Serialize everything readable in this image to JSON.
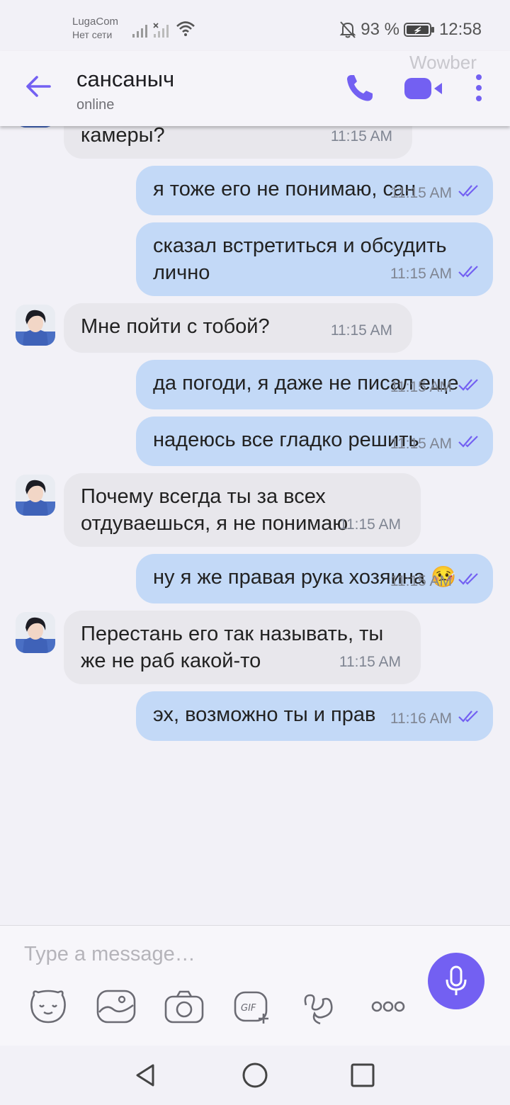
{
  "status": {
    "carrier": "LugaCom",
    "network": "Нет сети",
    "battery": "93 %",
    "time": "12:58"
  },
  "header": {
    "title": "сансаныч",
    "subtitle": "online",
    "watermark": "Wowber"
  },
  "messages": [
    {
      "dir": "in",
      "text": "Почему этот к камеры?",
      "time": "11:15 AM",
      "partial": true
    },
    {
      "dir": "out",
      "text": "я тоже его не понимаю, сан",
      "time": "11:15 AM"
    },
    {
      "dir": "out",
      "text": "сказал встретиться и обсудить лично",
      "time": "11:15 AM"
    },
    {
      "dir": "in",
      "text": "Мне пойти с тобой?",
      "time": "11:15 AM"
    },
    {
      "dir": "out",
      "text": "да погоди, я даже не писал еще",
      "time": "11:15 AM"
    },
    {
      "dir": "out",
      "text": "надеюсь все гладко решить",
      "time": "11:15 AM"
    },
    {
      "dir": "in",
      "text": "Почему всегда ты за всех отдуваешься, я не понимаю",
      "time": "11:15 AM"
    },
    {
      "dir": "out",
      "text": "ну я же правая рука хозяина 🤒",
      "time": "11:15 AM"
    },
    {
      "dir": "in",
      "text": "Перестань его так называть, ты же не раб какой-то",
      "time": "11:15 AM"
    },
    {
      "dir": "out",
      "text": "эх, возможно ты и прав",
      "time": "11:16 AM"
    }
  ],
  "composer": {
    "placeholder": "Type a message…"
  },
  "colors": {
    "accent": "#7360f2",
    "outgoing_bubble": "#c3d9f7",
    "incoming_bubble": "#e8e7ec"
  }
}
